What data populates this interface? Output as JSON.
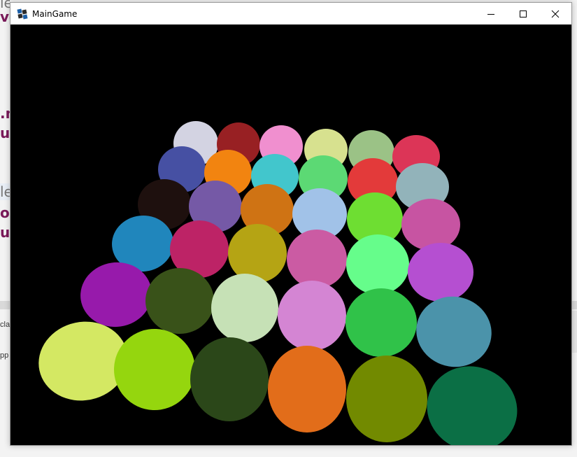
{
  "window": {
    "title": "MainGame",
    "controls": {
      "minimize": "minimize",
      "maximize": "maximize",
      "close": "close"
    }
  },
  "background_app": {
    "fragments": [
      "le",
      "vo",
      ".n",
      "ur",
      "le",
      "ol",
      "ur"
    ],
    "strip_text": [
      "cla",
      "pp"
    ]
  },
  "scene": {
    "background": "#000000",
    "balls": [
      "#d3d3e2",
      "#982023",
      "#f08fcf",
      "#d7e18f",
      "#9bc286",
      "#dc3557",
      "#4650a3",
      "#f28410",
      "#42c6cc",
      "#5cd974",
      "#e33a3a",
      "#92b3ba",
      "#1e100e",
      "#7559a6",
      "#cf7314",
      "#a1c2e8",
      "#6ede32",
      "#c754a2",
      "#2086bc",
      "#bd2366",
      "#b5a414",
      "#cb5ba3",
      "#66fd8b",
      "#b54fd1",
      "#971aab",
      "#395219",
      "#c6e1b6",
      "#d485d3",
      "#30c249",
      "#4b93aa",
      "#d4e863",
      "#95d60e",
      "#2b4719",
      "#e26d1a",
      "#728a00",
      "#0b6f45"
    ]
  }
}
